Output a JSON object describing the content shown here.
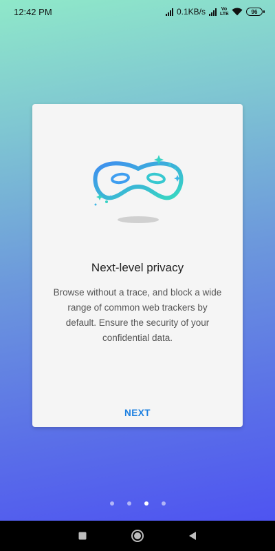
{
  "status_bar": {
    "time": "12:42 PM",
    "network_speed": "0.1KB/s",
    "lte_label": "Vo LTE",
    "battery_level": "96"
  },
  "onboarding": {
    "illustration_icon": "privacy-mask-icon",
    "title": "Next-level privacy",
    "description": "Browse without a trace, and block a wide range of common web trackers by default. Ensure the security of your confidential data.",
    "next_label": "NEXT"
  },
  "pager": {
    "total_pages": 4,
    "active_page": 3
  },
  "navigation_bar": {
    "buttons": [
      "recents",
      "home",
      "back"
    ]
  },
  "colors": {
    "accent": "#1c7fe0",
    "gradient_top": "#8fe8c9",
    "gradient_bottom": "#4b4df3"
  }
}
